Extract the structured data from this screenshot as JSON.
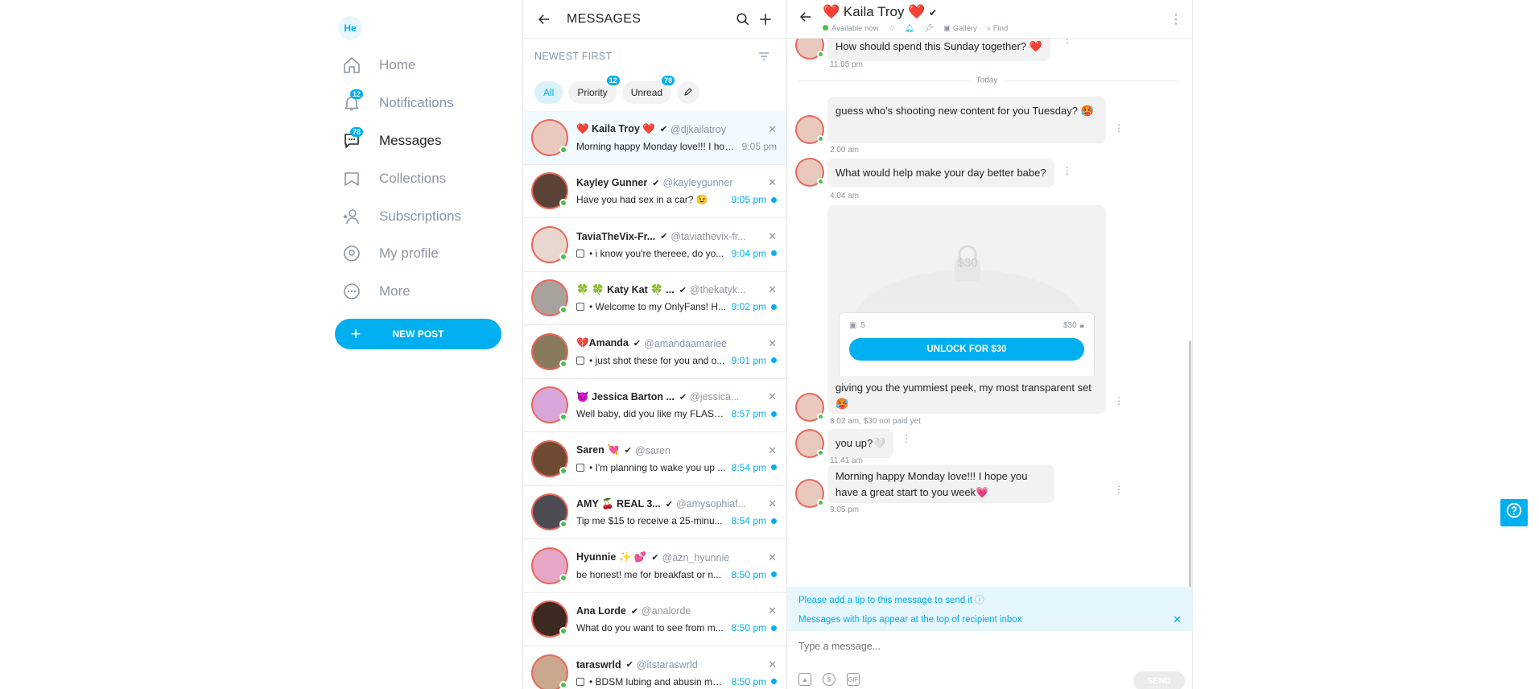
{
  "nav": {
    "avatar_initials": "He",
    "items": [
      {
        "label": "Home",
        "icon": "home-icon"
      },
      {
        "label": "Notifications",
        "icon": "bell-icon",
        "badge": "12"
      },
      {
        "label": "Messages",
        "icon": "chat-icon",
        "badge": "78"
      },
      {
        "label": "Collections",
        "icon": "bookmark-icon"
      },
      {
        "label": "Subscriptions",
        "icon": "user-star-icon"
      },
      {
        "label": "My profile",
        "icon": "profile-icon"
      },
      {
        "label": "More",
        "icon": "more-icon"
      }
    ],
    "new_post_label": "NEW POST"
  },
  "messages": {
    "title": "MESSAGES",
    "sort_label": "NEWEST FIRST",
    "filters": [
      {
        "label": "All",
        "active": true
      },
      {
        "label": "Priority",
        "badge": "12"
      },
      {
        "label": "Unread",
        "badge": "78"
      }
    ],
    "conversations": [
      {
        "name": "❤️ Kaila Troy ❤️",
        "handle": "@djkailatroy",
        "preview": "Morning happy Monday love!!! I hop...",
        "time": "9:05 pm",
        "unread": false,
        "active": true,
        "media": false,
        "avatar_color": "#e9c9bd"
      },
      {
        "name": "Kayley Gunner",
        "handle": "@kayleygunner",
        "preview": "Have you had sex in a car? 😉",
        "time": "9:05 pm",
        "unread": true,
        "media": false,
        "avatar_color": "#5a4236"
      },
      {
        "name": "TaviaTheVix-Fr...",
        "handle": "@taviathevix-fr...",
        "preview": "• i know you're thereee, do yo...",
        "time": "9:04 pm",
        "unread": true,
        "media": true,
        "avatar_color": "#e7d7cf"
      },
      {
        "name": "🍀 🍀 Katy Kat 🍀 ...",
        "handle": "@thekatyk...",
        "preview": "• Welcome to my OnlyFans! H...",
        "time": "9:02 pm",
        "unread": true,
        "media": true,
        "avatar_color": "#a8a29c"
      },
      {
        "name": "💔Amanda",
        "handle": "@amandaamariee",
        "preview": "• just shot these for you and o...",
        "time": "9:01 pm",
        "unread": true,
        "media": true,
        "avatar_color": "#8a7a5c"
      },
      {
        "name": "😈 Jessica Barton ...",
        "handle": "@jessica...",
        "preview": "Well baby, did you like my FLASH...",
        "time": "8:57 pm",
        "unread": true,
        "media": false,
        "avatar_color": "#d9a6d9"
      },
      {
        "name": "Saren 💘",
        "handle": "@saren",
        "preview": "• I'm planning to wake you up ...",
        "time": "8:54 pm",
        "unread": true,
        "media": true,
        "avatar_color": "#6e4a32"
      },
      {
        "name": "AMY 🍒 REAL 3...",
        "handle": "@amysophiaf...",
        "preview": "Tip me $15 to receive a 25-minu...",
        "time": "8:54 pm",
        "unread": true,
        "media": false,
        "avatar_color": "#4d4c52"
      },
      {
        "name": "Hyunnie ✨ 💕",
        "handle": "@azn_hyunnie",
        "preview": "be honest! me for breakfast or n...",
        "time": "8:50 pm",
        "unread": true,
        "media": false,
        "avatar_color": "#e8a6c6"
      },
      {
        "name": "Ana Lorde",
        "handle": "@analorde",
        "preview": "What do you want to see from m...",
        "time": "8:50 pm",
        "unread": true,
        "media": false,
        "avatar_color": "#3d2a22"
      },
      {
        "name": "taraswrld",
        "handle": "@itstaraswrld",
        "preview": "• BDSM lubing and abusin my ...",
        "time": "8:50 pm",
        "unread": true,
        "media": true,
        "avatar_color": "#c9a88e"
      }
    ]
  },
  "chat": {
    "name": "❤️ Kaila Troy ❤️",
    "status": "Available now",
    "actions": [
      "Gallery",
      "Find"
    ],
    "day_divider": "Today",
    "messages": [
      {
        "text": "How should spend this Sunday together? ❤️",
        "time": "11:05 pm"
      },
      {
        "text": "guess who's shooting new content for you Tuesday? 🥵",
        "time": "2:00 am"
      },
      {
        "text": "What would help make your day better babe?",
        "time": "4:04 am"
      },
      {
        "text": "giving you the yummiest peek, my most transparent set 🥵",
        "time": "8:02 am, $30 not paid yet"
      },
      {
        "text": "you up?🤍",
        "time": "11:41 am"
      },
      {
        "text": "Morning happy Monday love!!! I hope you have a great start to you week💗",
        "time": "9:05 pm"
      }
    ],
    "ppv": {
      "price": "$30",
      "media_count": "5",
      "price_tag": "$30",
      "unlock_label": "UNLOCK FOR $30"
    },
    "tip_notice": "Please add a tip to this message to send it",
    "tip_info": "Messages with tips appear at the top of recipient inbox",
    "input_placeholder": "Type a message...",
    "send_label": "SEND"
  },
  "colors": {
    "accent": "#00aff0",
    "online": "#49c14a",
    "ring": "#e8685a"
  }
}
